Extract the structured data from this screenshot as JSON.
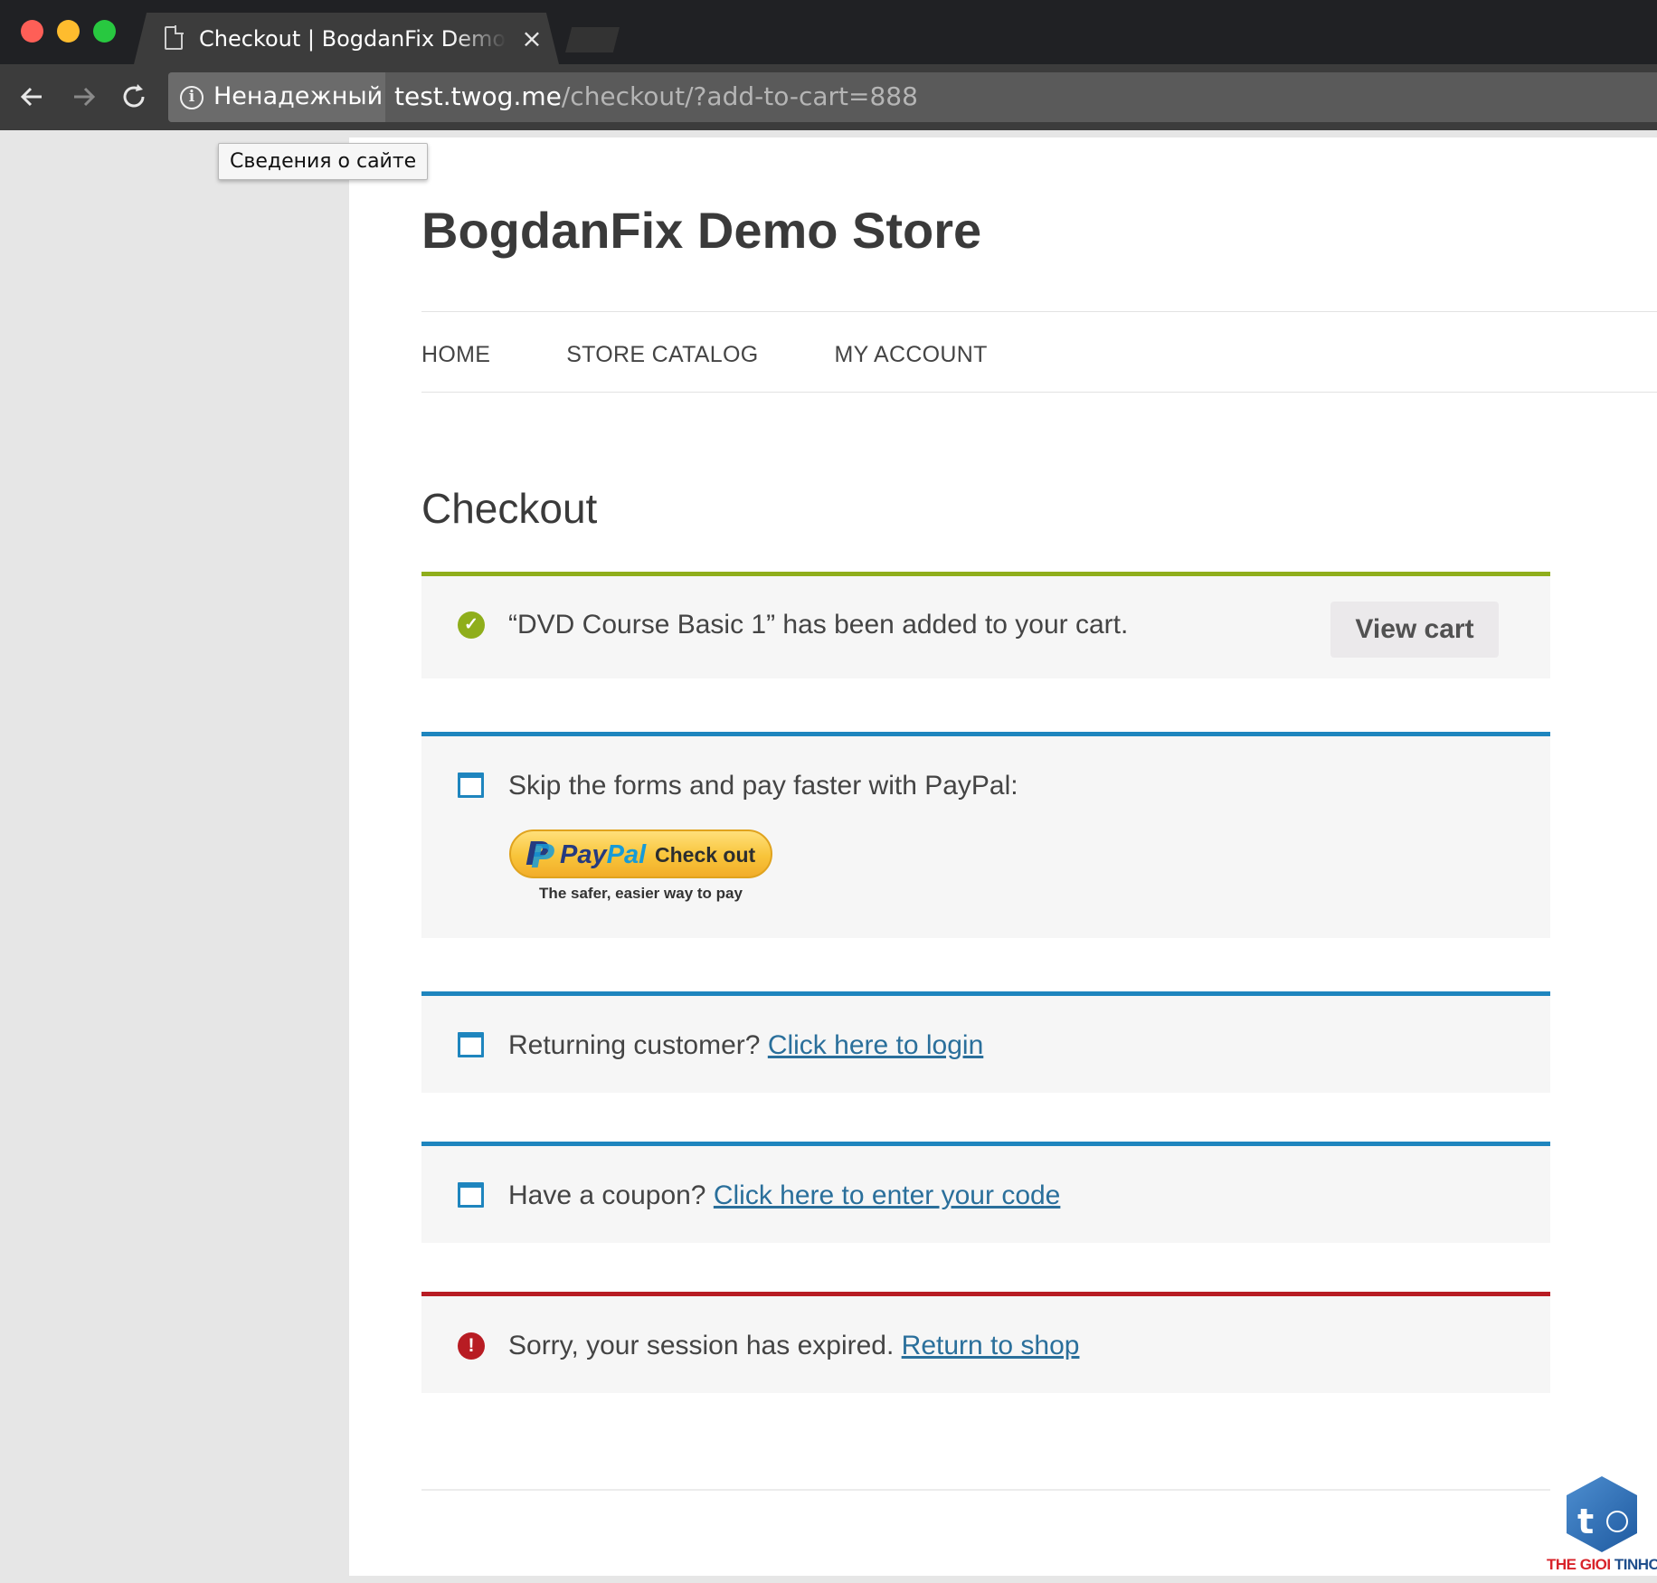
{
  "browser": {
    "tab_title": "Checkout | BogdanFix Demo Store",
    "tab_close_glyph": "×",
    "security_label": "Ненадежный",
    "url_host": "test.twog.me",
    "url_path": "/checkout/?add-to-cart=888",
    "tooltip": "Сведения о сайте",
    "icons": [
      "back-arrow-icon",
      "forward-arrow-icon",
      "reload-icon",
      "info-icon",
      "document-icon",
      "close-icon"
    ]
  },
  "site": {
    "title": "BogdanFix Demo Store",
    "nav": [
      "HOME",
      "STORE CATALOG",
      "MY ACCOUNT"
    ]
  },
  "page": {
    "title": "Checkout"
  },
  "notices": {
    "cart_added": {
      "text": "“DVD Course Basic 1” has been added to your cart.",
      "button": "View cart",
      "color": "#8fae1b"
    },
    "paypal": {
      "text": "Skip the forms and pay faster with PayPal:",
      "button_pay": "Pay",
      "button_pal": "Pal",
      "button_action": "Check out",
      "tagline": "The safer, easier way to pay",
      "color": "#1e85be"
    },
    "login": {
      "text": "Returning customer?",
      "link": "Click here to login"
    },
    "coupon": {
      "text": "Have a coupon?",
      "link": "Click here to enter your code"
    },
    "session": {
      "text": "Sorry, your session has expired.",
      "link": "Return to shop",
      "color": "#b81c23"
    }
  },
  "watermark": {
    "letter": "t",
    "name_a": "THE GIOI",
    "name_b": "TINHOC"
  }
}
